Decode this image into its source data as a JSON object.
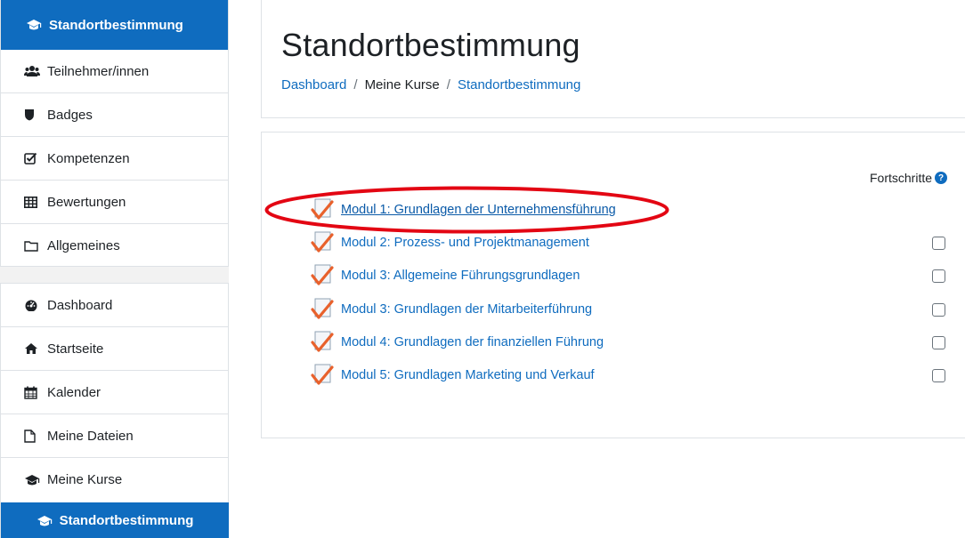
{
  "sidebar": {
    "course_title": "Standortbestimmung",
    "course_items": [
      {
        "label": "Teilnehmer/innen",
        "icon": "users-icon"
      },
      {
        "label": "Badges",
        "icon": "shield-icon"
      },
      {
        "label": "Kompetenzen",
        "icon": "checked-box-icon"
      },
      {
        "label": "Bewertungen",
        "icon": "table-icon"
      },
      {
        "label": "Allgemeines",
        "icon": "folder-icon"
      }
    ],
    "site_items": [
      {
        "label": "Dashboard",
        "icon": "dashboard-icon"
      },
      {
        "label": "Startseite",
        "icon": "home-icon"
      },
      {
        "label": "Kalender",
        "icon": "calendar-icon"
      },
      {
        "label": "Meine Dateien",
        "icon": "file-icon"
      },
      {
        "label": "Meine Kurse",
        "icon": "graduation-cap-icon"
      }
    ],
    "active_course": "Standortbestimmung"
  },
  "header": {
    "title": "Standortbestimmung",
    "breadcrumb": [
      "Dashboard",
      "Meine Kurse",
      "Standortbestimmung"
    ],
    "separator": "/"
  },
  "content": {
    "progress_label": "Fortschritte",
    "help_glyph": "?",
    "modules": [
      {
        "label": "Modul 1: Grundlagen der Unternehmensführung",
        "checkbox": false
      },
      {
        "label": "Modul 2: Prozess- und Projektmanagement",
        "checkbox": true
      },
      {
        "label": "Modul 3: Allgemeine Führungsgrundlagen",
        "checkbox": true
      },
      {
        "label": "Modul 3: Grundlagen der Mitarbeiterführung",
        "checkbox": true
      },
      {
        "label": "Modul 4: Grundlagen der finanziellen Führung",
        "checkbox": true
      },
      {
        "label": "Modul 5: Grundlagen Marketing und Verkauf",
        "checkbox": true
      }
    ]
  },
  "colors": {
    "accent": "#0f6cbf",
    "highlight_annotation": "#e30613",
    "check_mark": "#e8612c"
  }
}
